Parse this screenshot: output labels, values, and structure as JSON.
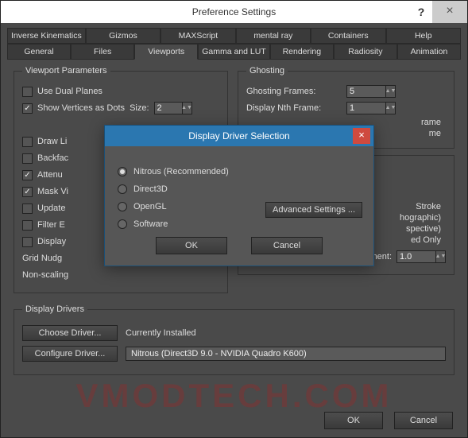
{
  "window": {
    "title": "Preference Settings",
    "help": "?",
    "close": "×"
  },
  "tabs_row1": [
    "Inverse Kinematics",
    "Gizmos",
    "MAXScript",
    "mental ray",
    "Containers",
    "Help"
  ],
  "tabs_row2": [
    "General",
    "Files",
    "Viewports",
    "Gamma and LUT",
    "Rendering",
    "Radiosity",
    "Animation"
  ],
  "active_tab": "Viewports",
  "viewport_params": {
    "legend": "Viewport Parameters",
    "use_dual": "Use Dual Planes",
    "show_verts": "Show Vertices as Dots",
    "size_label": "Size:",
    "size_value": "2",
    "draw_li": "Draw Li",
    "backfac": "Backfac",
    "attenu": "Attenu",
    "mask_vi": "Mask Vi",
    "update": "Update",
    "filter_e": "Filter E",
    "display": "Display",
    "grid_nudge": "Grid Nudg",
    "non_scaling": "Non-scaling"
  },
  "ghosting": {
    "legend": "Ghosting",
    "frames_label": "Ghosting Frames:",
    "frames_value": "5",
    "nth_label": "Display Nth Frame:",
    "nth_value": "1",
    "rame": "rame",
    "me": "me"
  },
  "mouse": {
    "stroke": "Stroke",
    "hographic": "hographic)",
    "spective": "spective)",
    "ed_only": "ed Only",
    "wheel_label": "Wheel Zoom Increment:",
    "wheel_value": "1.0"
  },
  "drivers": {
    "legend": "Display Drivers",
    "choose": "Choose Driver...",
    "configure": "Configure Driver...",
    "currently": "Currently Installed",
    "installed": "Nitrous (Direct3D 9.0 - NVIDIA Quadro K600)"
  },
  "bottom": {
    "ok": "OK",
    "cancel": "Cancel"
  },
  "dialog": {
    "title": "Display Driver Selection",
    "close": "×",
    "nitrous": "Nitrous (Recommended)",
    "direct3d": "Direct3D",
    "opengl": "OpenGL",
    "software": "Software",
    "advanced": "Advanced Settings ...",
    "ok": "OK",
    "cancel": "Cancel"
  },
  "watermark": "VMODTECH.COM"
}
